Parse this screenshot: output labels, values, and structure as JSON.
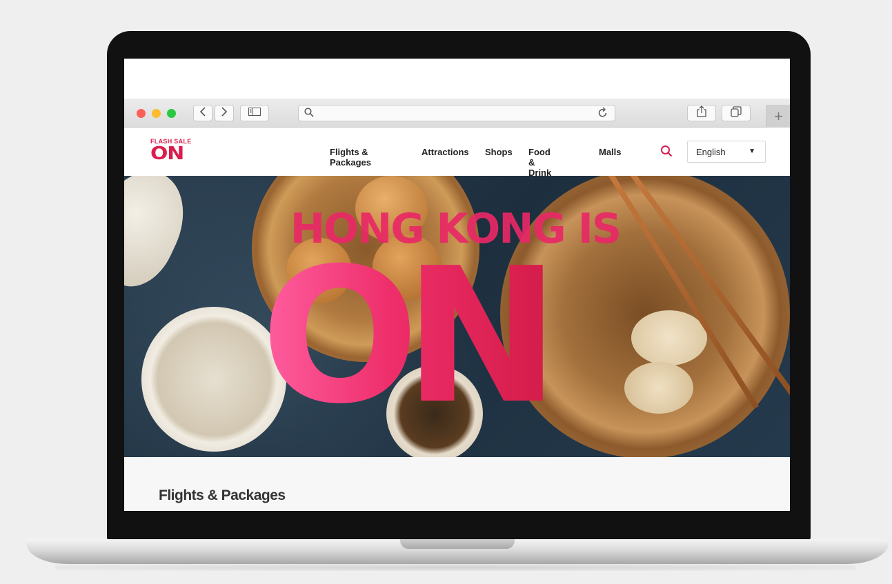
{
  "browser": {
    "url_value": "",
    "new_tab_symbol": "+"
  },
  "site": {
    "logo": {
      "top": "FLASH SALE",
      "bottom": "ON"
    },
    "nav": [
      {
        "label": "Flights & Packages"
      },
      {
        "label": "Attractions"
      },
      {
        "label": "Shops"
      },
      {
        "label": "Food & Drink"
      },
      {
        "label": "Malls"
      }
    ],
    "language": {
      "selected": "English"
    }
  },
  "hero": {
    "line1": "HONG KONG IS",
    "line2": "ON"
  },
  "section": {
    "title": "Flights & Packages"
  },
  "colors": {
    "brand": "#d81f4e",
    "hero_bg": "#1d2f3f"
  },
  "icons": [
    "back-icon",
    "forward-icon",
    "sidebar-icon",
    "search-icon",
    "reload-icon",
    "share-icon",
    "tabs-icon",
    "new-tab-icon"
  ]
}
